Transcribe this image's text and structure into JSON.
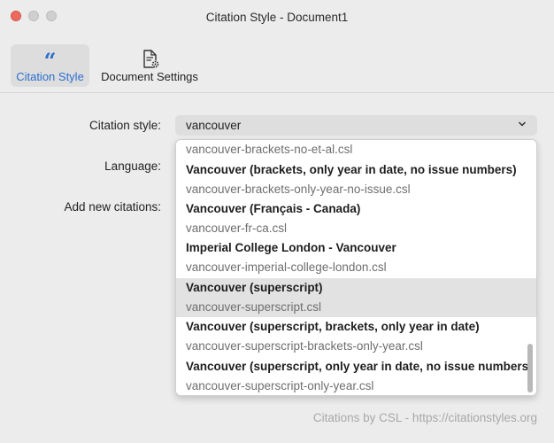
{
  "window": {
    "title": "Citation Style - Document1"
  },
  "toolbar": {
    "tabs": [
      {
        "label": "Citation Style",
        "icon": "quote-icon",
        "active": true
      },
      {
        "label": "Document Settings",
        "icon": "document-settings-icon",
        "active": false
      }
    ],
    "quote_glyph": "“"
  },
  "form": {
    "citation_style_label": "Citation style:",
    "citation_style_value": "vancouver",
    "language_label": "Language:",
    "add_new_citations_label": "Add new citations:"
  },
  "dropdown": {
    "items": [
      {
        "title": "",
        "file": "vancouver-brackets-no-et-al.csl"
      },
      {
        "title": "Vancouver (brackets, only year in date, no issue numbers)",
        "file": "vancouver-brackets-only-year-no-issue.csl"
      },
      {
        "title": "Vancouver (Français - Canada)",
        "file": "vancouver-fr-ca.csl"
      },
      {
        "title": "Imperial College London - Vancouver",
        "file": "vancouver-imperial-college-london.csl"
      },
      {
        "title": "Vancouver (superscript)",
        "file": "vancouver-superscript.csl",
        "selected": true
      },
      {
        "title": "Vancouver (superscript, brackets, only year in date)",
        "file": "vancouver-superscript-brackets-only-year.csl"
      },
      {
        "title": "Vancouver (superscript, only year in date, no issue numbers)",
        "file": "vancouver-superscript-only-year.csl"
      }
    ]
  },
  "footer": {
    "text": "Citations by CSL - https://citationstyles.org"
  },
  "colors": {
    "accent": "#2c6fcf",
    "close": "#ec6a5e",
    "selected_row": "#e2e2e2"
  }
}
